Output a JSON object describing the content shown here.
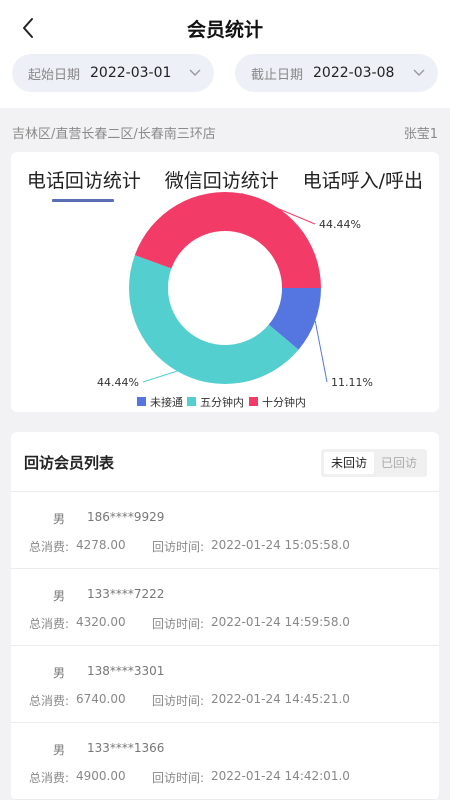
{
  "header": {
    "title": "会员统计",
    "back_icon": "chevron-left-icon"
  },
  "filters": {
    "start": {
      "label": "起始日期",
      "value": "2022-03-01",
      "icon": "chevron-down-icon"
    },
    "end": {
      "label": "截止日期",
      "value": "2022-03-08",
      "icon": "chevron-down-icon"
    }
  },
  "breadcrumb": {
    "path": "吉林区/直营长春二区/长春南三环店",
    "user": "张莹1"
  },
  "tabs": [
    {
      "label": "电话回访统计",
      "active": true
    },
    {
      "label": "微信回访统计",
      "active": false
    },
    {
      "label": "电话呼入/呼出",
      "active": false
    }
  ],
  "chart_data": {
    "type": "pie",
    "donut": true,
    "labels": [
      "未接通",
      "五分钟内",
      "十分钟内"
    ],
    "values": [
      11.11,
      44.44,
      44.44
    ],
    "value_labels": [
      "11.11%",
      "44.44%",
      "44.44%"
    ],
    "colors": [
      "#5576e0",
      "#54cfcf",
      "#f23c67"
    ],
    "legend_position": "bottom"
  },
  "list": {
    "title": "回访会员列表",
    "segments": [
      {
        "label": "未回访",
        "active": true
      },
      {
        "label": "已回访",
        "active": false
      }
    ],
    "spend_label": "总消费:",
    "visit_label": "回访时间:",
    "rows": [
      {
        "gender": "男",
        "phone": "186****9929",
        "spend": "4278.00",
        "visit_time": "2022-01-24 15:05:58.0"
      },
      {
        "gender": "男",
        "phone": "133****7222",
        "spend": "4320.00",
        "visit_time": "2022-01-24 14:59:58.0"
      },
      {
        "gender": "男",
        "phone": "138****3301",
        "spend": "6740.00",
        "visit_time": "2022-01-24 14:45:21.0"
      },
      {
        "gender": "男",
        "phone": "133****1366",
        "spend": "4900.00",
        "visit_time": "2022-01-24 14:42:01.0"
      }
    ]
  }
}
